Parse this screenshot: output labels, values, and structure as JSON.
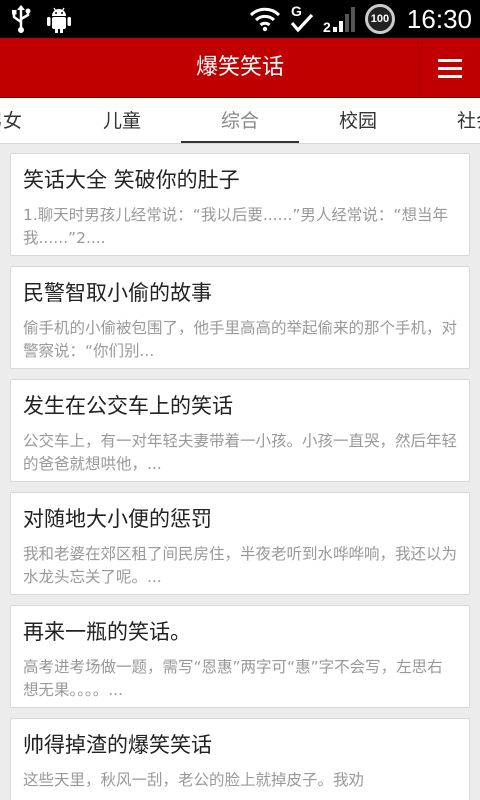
{
  "status_bar": {
    "time": "16:30",
    "battery": "100",
    "network": "G",
    "icons": [
      "usb-icon",
      "android-debug-icon",
      "wifi-icon",
      "sync-check-icon",
      "signal-icon",
      "battery-icon"
    ]
  },
  "app": {
    "title": "爆笑笑话",
    "menu_icon": "hamburger-menu-icon",
    "accent_color": "#c00000"
  },
  "tabs": [
    {
      "label": "男女",
      "active": false
    },
    {
      "label": "儿童",
      "active": false
    },
    {
      "label": "综合",
      "active": true
    },
    {
      "label": "校园",
      "active": false
    },
    {
      "label": "社会",
      "active": false
    }
  ],
  "articles": [
    {
      "title": "笑话大全 笑破你的肚子",
      "summary": "1.聊天时男孩儿经常说：“我以后要......”男人经常说：“想当年我......”2...."
    },
    {
      "title": "民警智取小偷的故事",
      "summary": "偷手机的小偷被包围了，他手里高高的举起偷来的那个手机，对警察说：“你们别..."
    },
    {
      "title": "发生在公交车上的笑话",
      "summary": "公交车上，有一对年轻夫妻带着一小孩。小孩一直哭，然后年轻的爸爸就想哄他，..."
    },
    {
      "title": "对随地大小便的惩罚",
      "summary": "我和老婆在郊区租了间民房住，半夜老听到水哗哗响，我还以为水龙头忘关了呢。..."
    },
    {
      "title": "再来一瓶的笑话。",
      "summary": "高考进考场做一题，需写“恩惠”两字可“惠”字不会写，左思右想无果。。。。..."
    },
    {
      "title": "帅得掉渣的爆笑笑话",
      "summary": "这些天里，秋风一刮，老公的脸上就掉皮子。我劝"
    }
  ]
}
